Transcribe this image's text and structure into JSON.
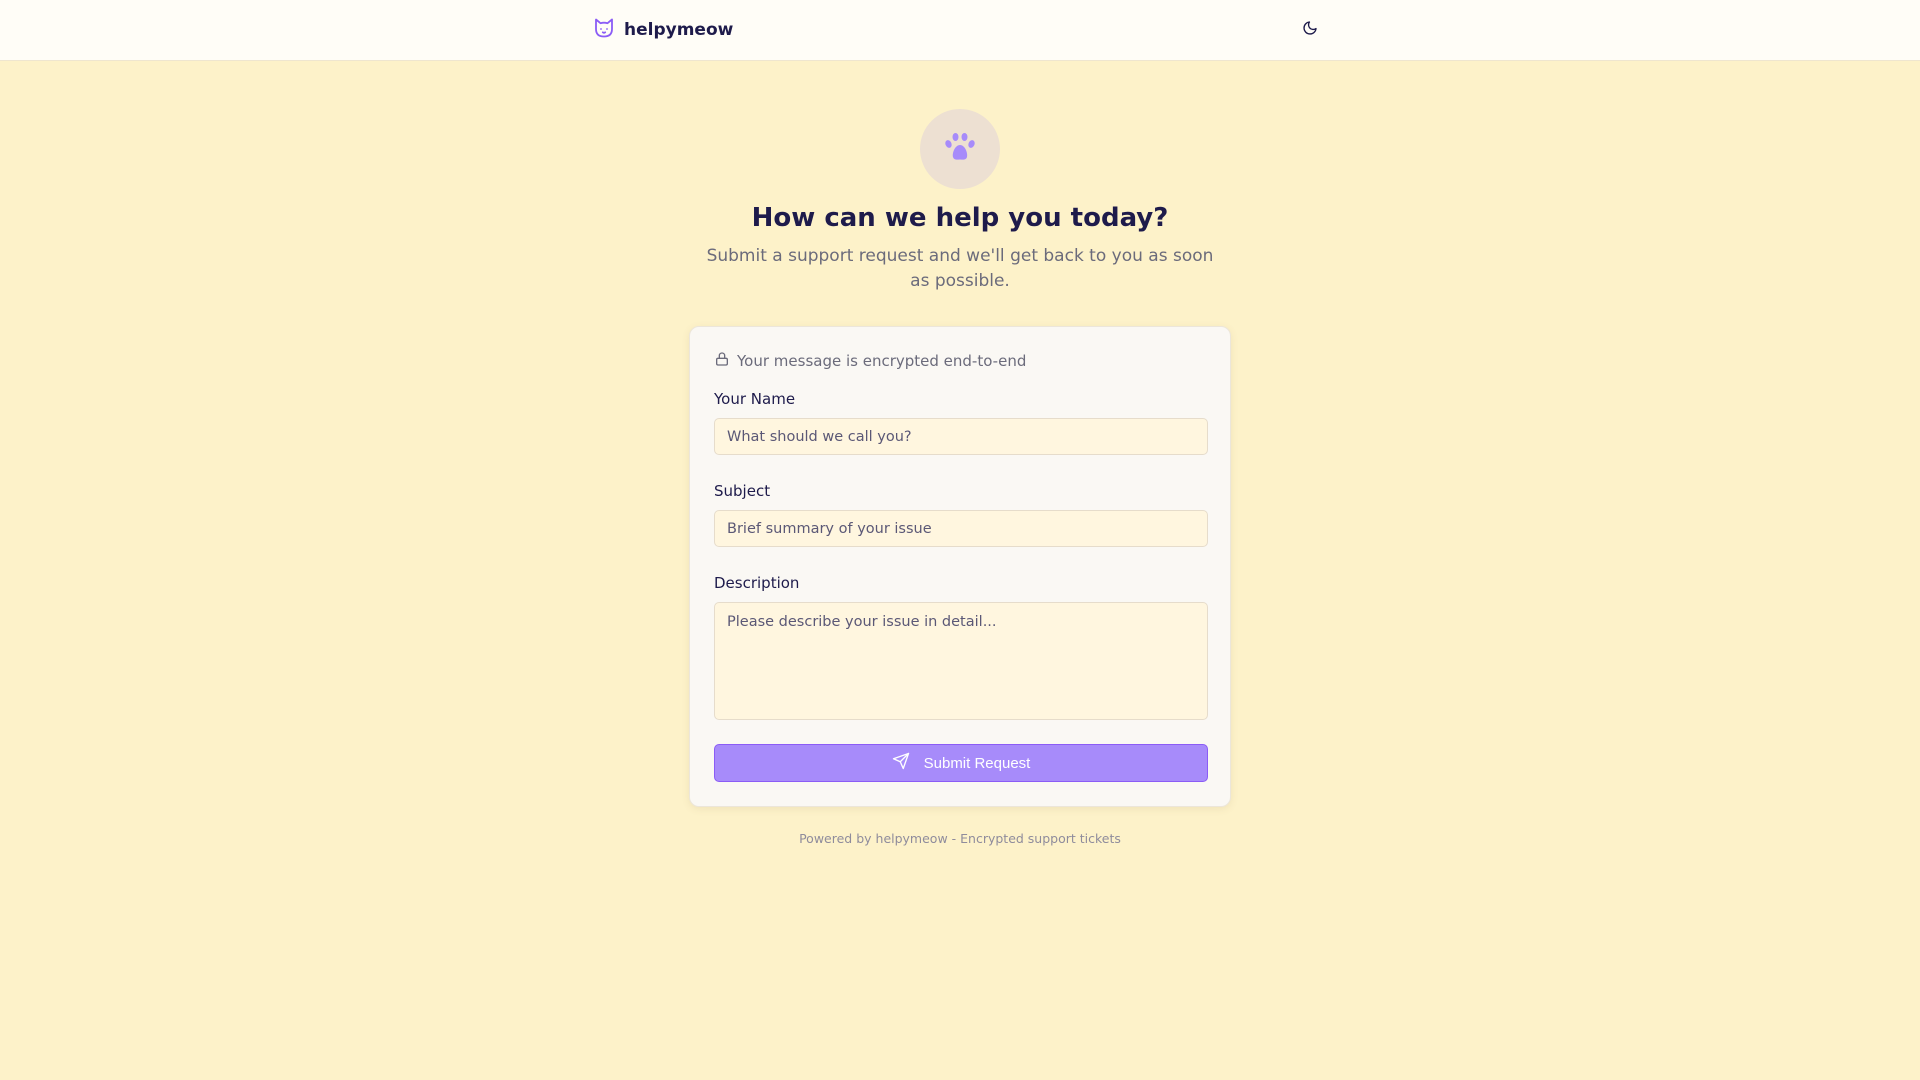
{
  "header": {
    "brand_name": "helpymeow",
    "brand_icon": "cat-icon",
    "theme_toggle_icon": "moon-icon"
  },
  "hero": {
    "icon": "paw-icon",
    "title": "How can we help you today?",
    "subtitle": "Submit a support request and we'll get back to you as soon as possible."
  },
  "form": {
    "encryption_notice": "Your message is encrypted end-to-end",
    "encryption_icon": "lock-icon",
    "name": {
      "label": "Your Name",
      "placeholder": "What should we call you?",
      "value": ""
    },
    "subject": {
      "label": "Subject",
      "placeholder": "Brief summary of your issue",
      "value": ""
    },
    "description": {
      "label": "Description",
      "placeholder": "Please describe your issue in detail...",
      "value": ""
    },
    "submit_label": "Submit Request",
    "submit_icon": "send-icon"
  },
  "footer": {
    "text": "Powered by helpymeow - Encrypted support tickets"
  },
  "colors": {
    "background": "#fdf2c9",
    "accent": "#a78bfa",
    "heading": "#1e1b4b"
  }
}
